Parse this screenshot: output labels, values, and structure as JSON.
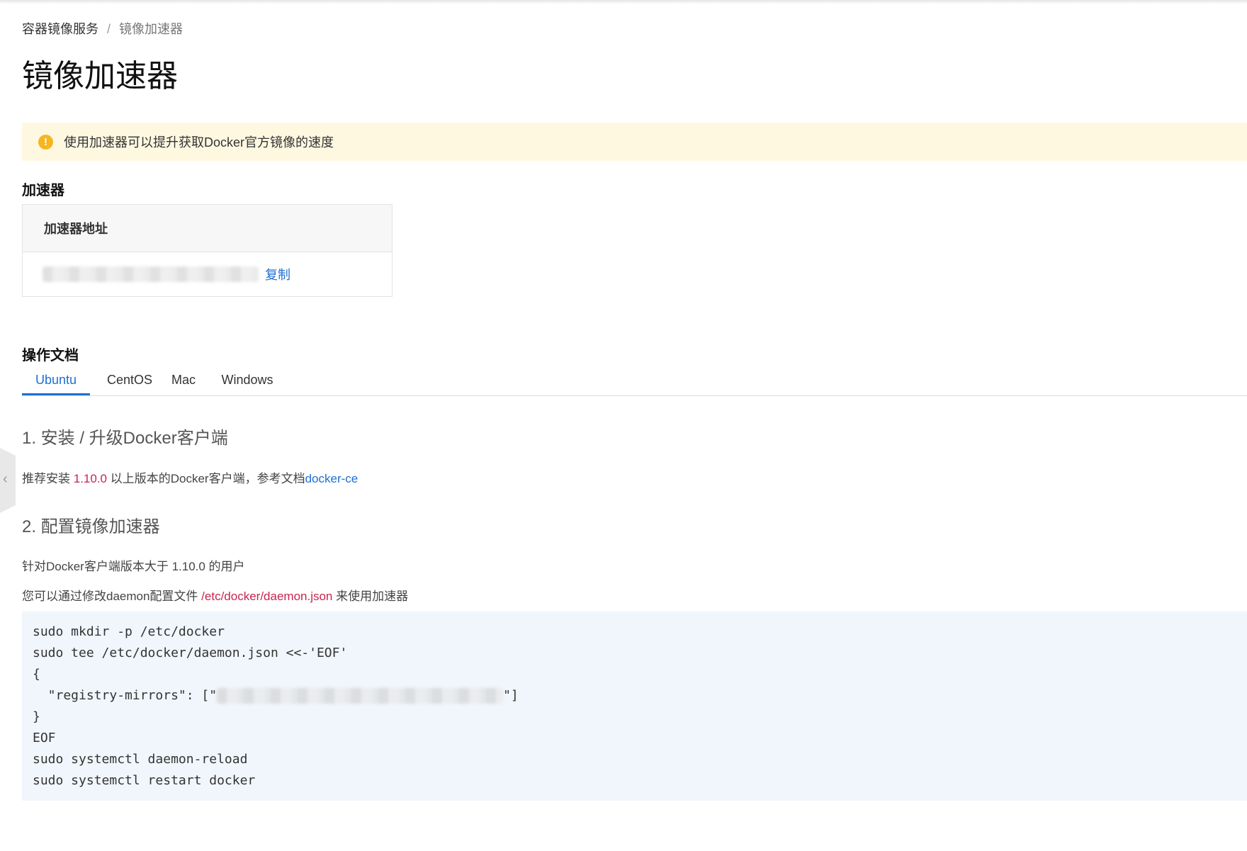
{
  "breadcrumb": {
    "parent": "容器镜像服务",
    "separator": "/",
    "current": "镜像加速器"
  },
  "page_title": "镜像加速器",
  "notice": {
    "icon": "warning-icon",
    "icon_glyph": "!",
    "text": "使用加速器可以提升获取Docker官方镜像的速度",
    "color": "#fff8e1"
  },
  "accelerator": {
    "section_title": "加速器",
    "column_header": "加速器地址",
    "copy_label": "复制"
  },
  "docs": {
    "section_title": "操作文档",
    "tabs": [
      "Ubuntu",
      "CentOS",
      "Mac",
      "Windows"
    ],
    "active_tab": "Ubuntu",
    "step1": {
      "title": "1. 安装 / 升级Docker客户端",
      "text_before": "推荐安装 ",
      "version": "1.10.0",
      "text_after": " 以上版本的Docker客户端，参考文档",
      "link": "docker-ce"
    },
    "step2": {
      "title": "2. 配置镜像加速器",
      "line1": "针对Docker客户端版本大于 1.10.0 的用户",
      "line2_before": "您可以通过修改daemon配置文件 ",
      "line2_path": "/etc/docker/daemon.json",
      "line2_after": " 来使用加速器"
    },
    "code_lines": [
      "sudo mkdir -p /etc/docker",
      "sudo tee /etc/docker/daemon.json <<-'EOF'",
      "{",
      "  \"registry-mirrors\": [\"",
      "}",
      "EOF",
      "sudo systemctl daemon-reload",
      "sudo systemctl restart docker"
    ],
    "code_line4_tail": "\"]"
  },
  "colors": {
    "accent": "#1f6fd1",
    "highlight_red": "#c7254e",
    "warning": "#f5b622",
    "code_bg": "#f1f6fc"
  },
  "side_handle_icon": "chevron-left-icon"
}
